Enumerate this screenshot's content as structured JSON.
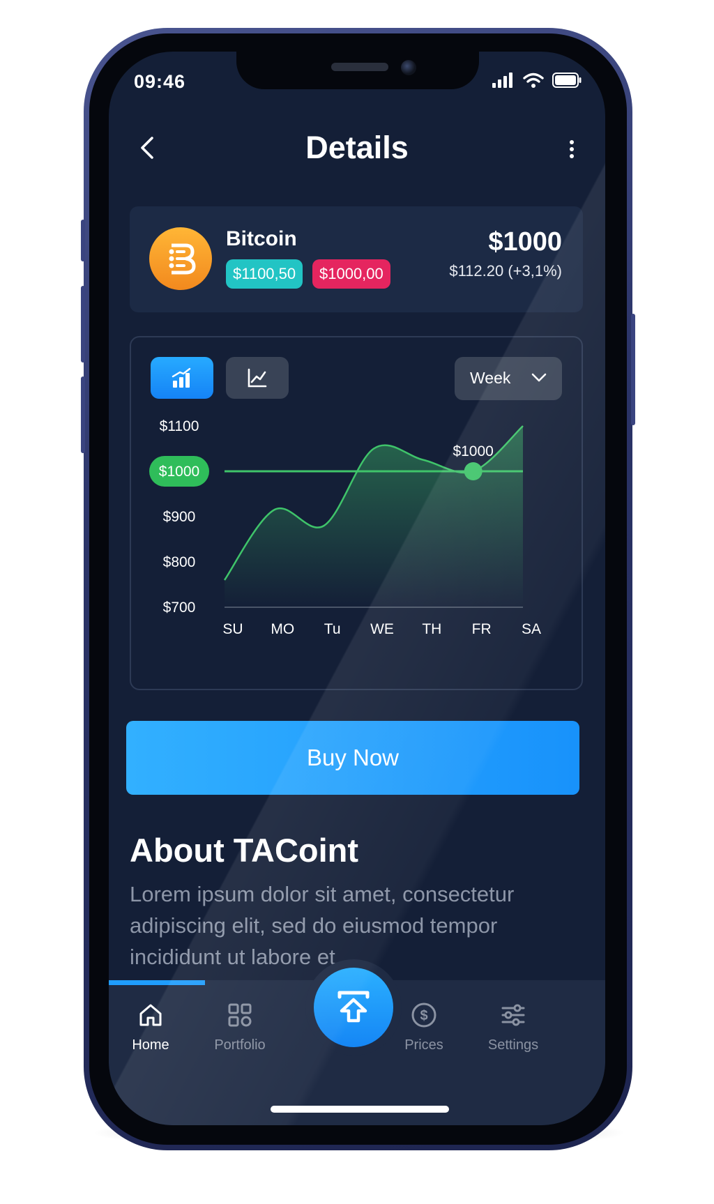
{
  "status": {
    "time": "09:46"
  },
  "header": {
    "title": "Details"
  },
  "coin": {
    "name": "Bitcoin",
    "buy_price": "$1100,50",
    "sell_price": "$1000,00",
    "price": "$1000",
    "change": "$112.20 (+3,1%)",
    "logo_color": "#f7a52b"
  },
  "chart_controls": {
    "bar_icon": "bar-chart-icon",
    "line_icon": "line-chart-icon",
    "period": "Week"
  },
  "chart_data": {
    "type": "area",
    "x": [
      "SU",
      "MO",
      "Tu",
      "WE",
      "TH",
      "FR",
      "SA"
    ],
    "y_ticks": [
      "$1100",
      "$1000",
      "$900",
      "$800",
      "$700"
    ],
    "ylim": [
      700,
      1100
    ],
    "highlight": {
      "value": "$1000",
      "label": "$1000",
      "reference": 1000,
      "x": "FR"
    },
    "series": [
      {
        "values": [
          760,
          915,
          880,
          1050,
          1025,
          1000,
          1100
        ]
      }
    ],
    "line_color": "#3fc46a",
    "grid": false
  },
  "cta": {
    "label": "Buy Now"
  },
  "about": {
    "title": "About TACoint",
    "text": "Lorem ipsum dolor sit amet, consectetur adipiscing elit, sed do eiusmod tempor incididunt ut labore et"
  },
  "tabbar": {
    "items": [
      {
        "label": "Home",
        "icon": "home-icon",
        "active": true
      },
      {
        "label": "Portfolio",
        "icon": "grid-icon",
        "active": false
      },
      {
        "label": "",
        "icon": "upload-icon",
        "active": false
      },
      {
        "label": "Prices",
        "icon": "dollar-icon",
        "active": false
      },
      {
        "label": "Settings",
        "icon": "sliders-icon",
        "active": false
      }
    ]
  },
  "colors": {
    "accent": "#1f9dfd",
    "background": "#141f37",
    "card": "#1c2a45",
    "buy_tag": "#22c4c4",
    "sell_tag": "#e5255f",
    "chart_line": "#3fc46a"
  }
}
